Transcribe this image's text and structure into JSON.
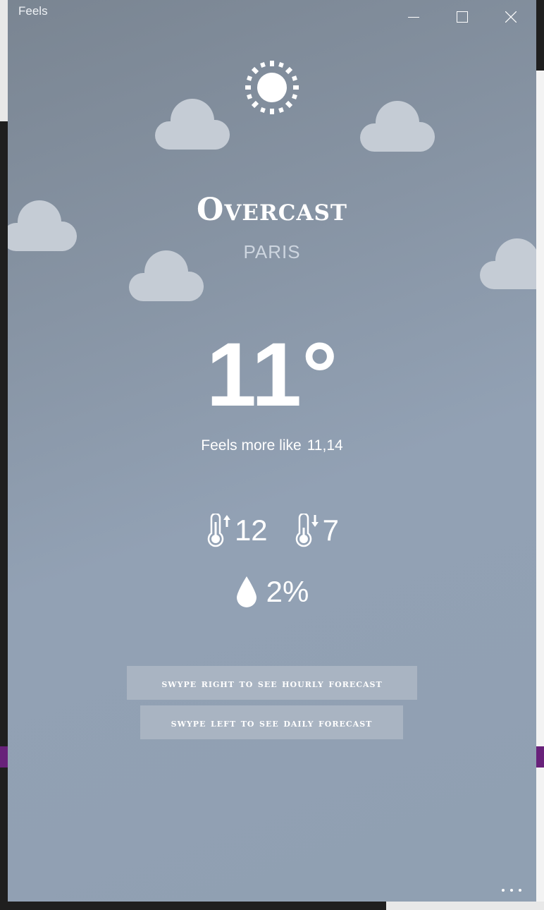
{
  "window": {
    "title": "Feels",
    "controls": {
      "minimize_icon": "minimize-icon",
      "maximize_icon": "maximize-icon",
      "close_icon": "close-icon"
    }
  },
  "weather": {
    "condition": "Overcast",
    "city": "PARIS",
    "temperature": "11°",
    "feels_label": "Feels more like",
    "feels_value": "11,14",
    "max_temp": "12",
    "min_temp": "7",
    "precipitation": "2%",
    "icon": "sun-icon"
  },
  "hints": {
    "hourly": "swype right to see hourly forecast",
    "daily": "swype left to see daily forecast"
  },
  "colors": {
    "background_top": "#7a8592",
    "background_bottom": "#92a1b4",
    "cloud": "#c5ccd5",
    "button_bg": "#a9b4c2",
    "text": "#ffffff"
  }
}
